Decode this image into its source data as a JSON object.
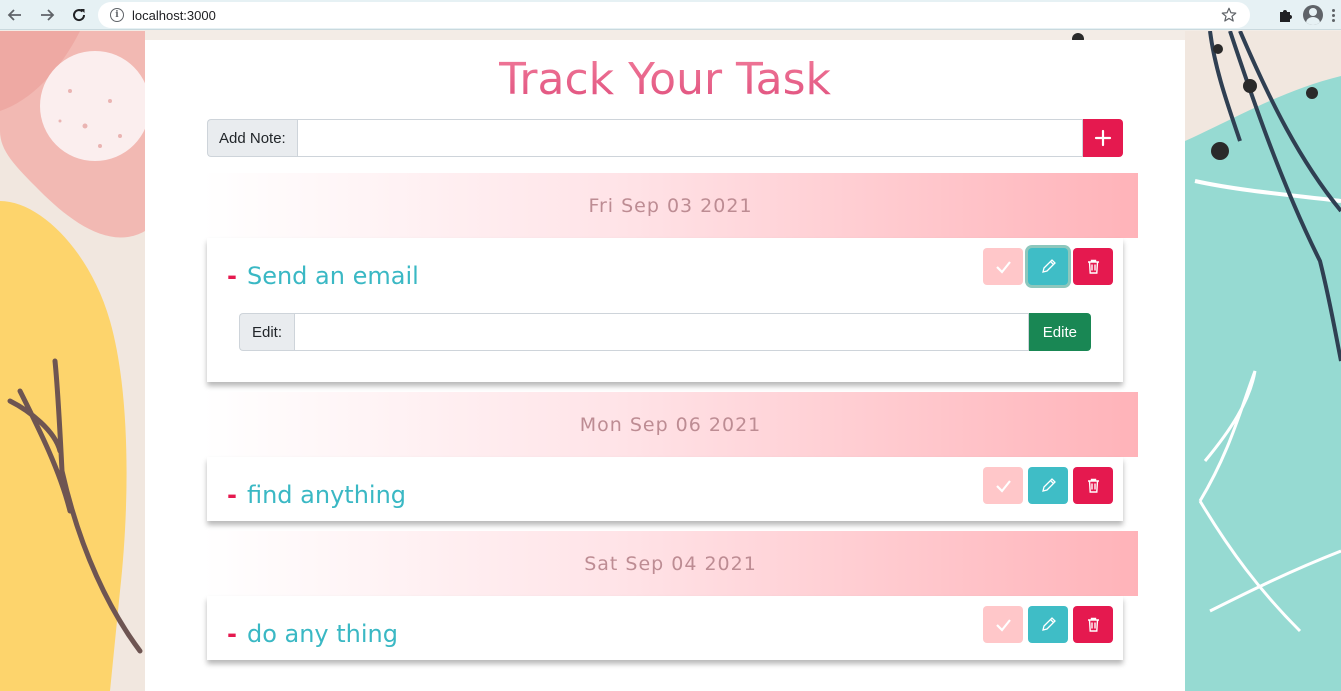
{
  "browser": {
    "url": "localhost:3000"
  },
  "app": {
    "title": "Track Your Task",
    "add_note_label": "Add Note:",
    "add_note_value": ""
  },
  "groups": [
    {
      "date": "Fri Sep 03 2021",
      "task": "Send an email",
      "editing": true,
      "edit_label": "Edit:",
      "edit_value": "",
      "edit_button": "Edite"
    },
    {
      "date": "Mon Sep 06 2021",
      "task": "find anything",
      "editing": false
    },
    {
      "date": "Sat Sep 04 2021",
      "task": "do any thing",
      "editing": false
    }
  ],
  "icons": {
    "back": "arrow-left-icon",
    "forward": "arrow-right-icon",
    "reload": "reload-icon",
    "site_info": "info-icon",
    "bookmark": "star-icon",
    "extensions": "puzzle-icon",
    "profile": "avatar-icon",
    "menu": "kebab-icon",
    "add": "plus-icon",
    "complete": "check-icon",
    "edit": "pencil-icon",
    "delete": "trash-icon"
  },
  "colors": {
    "title": "#e8668c",
    "task_text": "#3ab8c4",
    "accent_red": "#e5194f",
    "edit_teal": "#3fbdc6",
    "done_pink": "#ffc7c9",
    "submit_green": "#198754"
  }
}
